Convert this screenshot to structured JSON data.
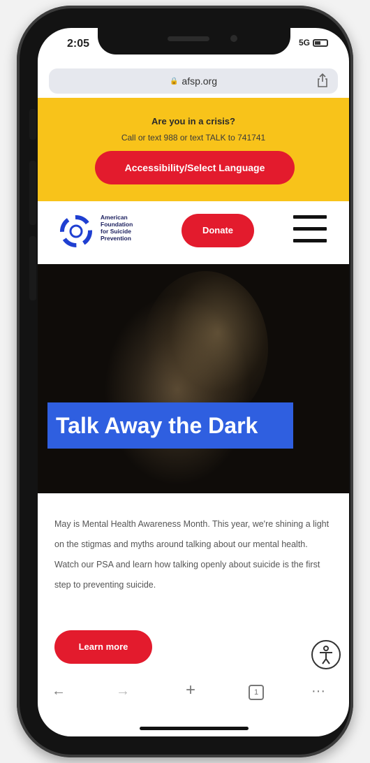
{
  "status": {
    "time": "2:05",
    "signal": "5G"
  },
  "browser": {
    "url": "afsp.org"
  },
  "crisis_banner": {
    "title": "Are you in a crisis?",
    "text": "Call or text 988 or text TALK to 741741",
    "language_button": "Accessibility/Select Language"
  },
  "header": {
    "logo_lines": [
      "American",
      "Foundation",
      "for Suicide",
      "Prevention"
    ],
    "donate_label": "Donate"
  },
  "hero": {
    "title": "Talk Away the Dark"
  },
  "main": {
    "body": "May is Mental Health Awareness Month. This year, we're shining a light on the stigmas and myths around talking about our mental health. Watch our PSA and learn how talking openly about suicide is the first step to preventing suicide.",
    "learn_more": "Learn more"
  },
  "toolbar": {
    "back": "←",
    "forward": "→",
    "new_tab": "+",
    "tabs": "1",
    "more": "···"
  },
  "colors": {
    "brand_red": "#e31b2d",
    "banner_yellow": "#f8c31a",
    "hero_blue": "#2f5fe0",
    "logo_blue": "#1f3fd1"
  }
}
